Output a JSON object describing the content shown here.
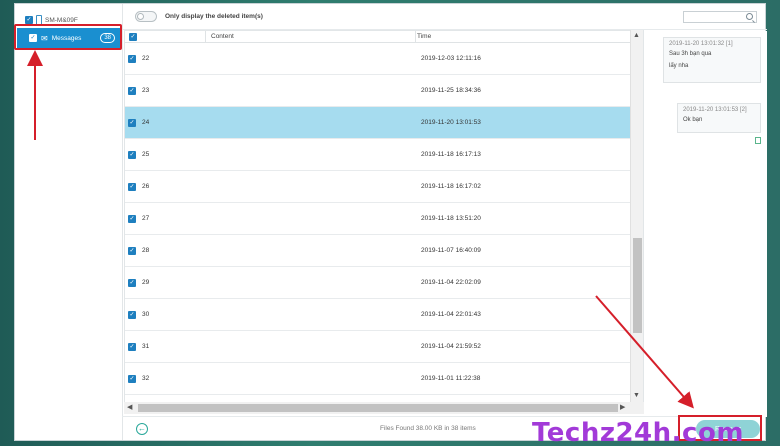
{
  "sidebar": {
    "device_name": "SM-M&09F",
    "messages_label": "Messages",
    "messages_count": "38"
  },
  "topbar": {
    "toggle_label": "Only display the deleted item(s)"
  },
  "table": {
    "headers": {
      "content": "Content",
      "time": "Time"
    },
    "rows": [
      {
        "num": "22",
        "time": "2019-12-03 12:11:16"
      },
      {
        "num": "23",
        "time": "2019-11-25 18:34:36"
      },
      {
        "num": "24",
        "time": "2019-11-20 13:01:53"
      },
      {
        "num": "25",
        "time": "2019-11-18 16:17:13"
      },
      {
        "num": "26",
        "time": "2019-11-18 16:17:02"
      },
      {
        "num": "27",
        "time": "2019-11-18 13:51:20"
      },
      {
        "num": "28",
        "time": "2019-11-07 16:40:09"
      },
      {
        "num": "29",
        "time": "2019-11-04 22:02:09"
      },
      {
        "num": "30",
        "time": "2019-11-04 22:01:43"
      },
      {
        "num": "31",
        "time": "2019-11-04 21:59:52"
      },
      {
        "num": "32",
        "time": "2019-11-01 11:22:38"
      }
    ],
    "selected_index": 2
  },
  "preview": {
    "bubble1": {
      "timestamp": "2019-11-20 13:01:32  [1]",
      "line1": "Sau 3h bạn qua",
      "line2": "lấy nha"
    },
    "bubble2": {
      "timestamp": "2019-11-20 13:01:53  [2]",
      "line1": "Ok bạn"
    }
  },
  "bottombar": {
    "files_found": "Files Found 38.00 KB in 38 items",
    "recover_label": "Recover"
  },
  "watermark": "Techz24h.com",
  "colors": {
    "accent": "#1a8fd0",
    "selected_row": "#a6dcef",
    "annotation_red": "#d51f2a",
    "recover_button": "#8fd3d6",
    "watermark": "#a23ad8"
  }
}
